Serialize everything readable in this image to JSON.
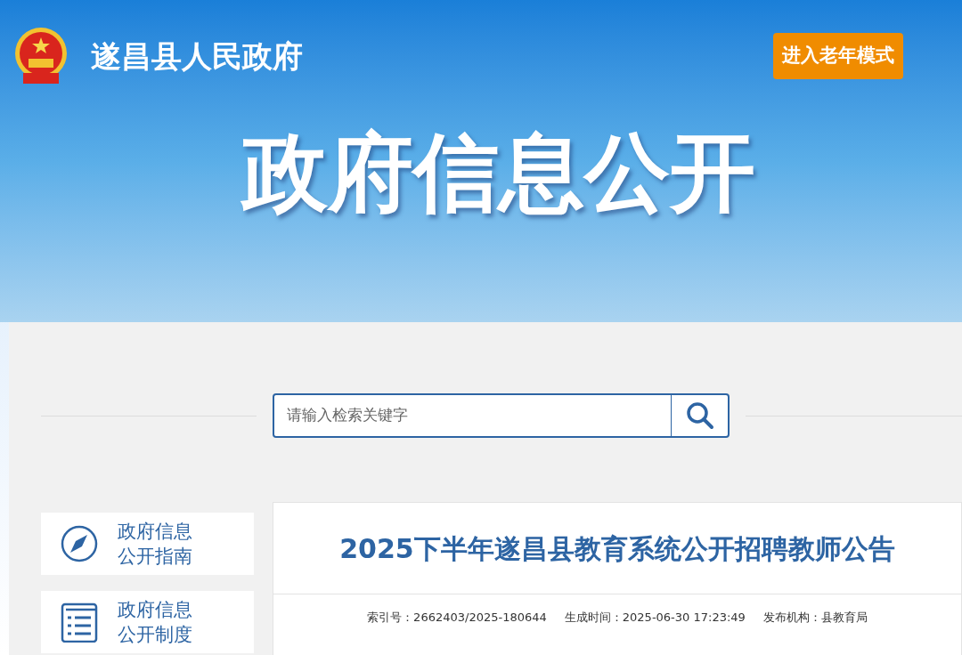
{
  "header": {
    "site_name": "遂昌县人民政府",
    "elder_mode_button": "进入老年模式",
    "banner_title": "政府信息公开"
  },
  "search": {
    "placeholder": "请输入检索关键字"
  },
  "sidebar": {
    "items": [
      {
        "kind": "guide",
        "label_line1": "政府信息",
        "label_line2": "公开指南"
      },
      {
        "kind": "rules",
        "label_line1": "政府信息",
        "label_line2": "公开制度"
      }
    ]
  },
  "article": {
    "title": "2025下半年遂昌县教育系统公开招聘教师公告",
    "meta": [
      "索引号：2662403/2025-180644",
      "生成时间：2025-06-30 17:23:49",
      "发布机构：县教育局"
    ]
  }
}
